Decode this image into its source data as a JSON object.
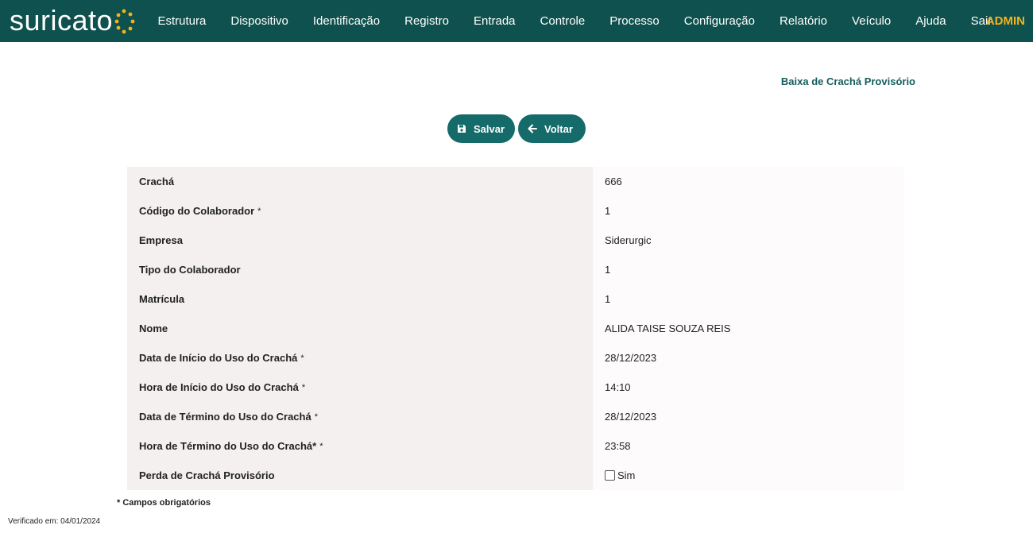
{
  "brand": {
    "name": "suricato",
    "accent": "#f4b31c"
  },
  "nav": {
    "background": "#0f514e",
    "items": [
      "Estrutura",
      "Dispositivo",
      "Identificação",
      "Registro",
      "Entrada",
      "Controle",
      "Processo",
      "Configuração",
      "Relatório",
      "Veículo",
      "Ajuda",
      "Sair"
    ],
    "user": "ADMIN"
  },
  "page": {
    "title": "Baixa de Crachá Provisório"
  },
  "actions": {
    "save_label": "Salvar",
    "save_icon": "floppy-disk-icon",
    "back_label": "Voltar",
    "back_icon": "arrow-left-icon"
  },
  "form": {
    "rows": [
      {
        "label": "Crachá",
        "required": "",
        "value": "666"
      },
      {
        "label": "Código do Colaborador",
        "required": "*",
        "value": "1"
      },
      {
        "label": "Empresa",
        "required": "",
        "value": "Siderurgic"
      },
      {
        "label": "Tipo do Colaborador",
        "required": "",
        "value": "1"
      },
      {
        "label": "Matrícula",
        "required": "",
        "value": "1"
      },
      {
        "label": "Nome",
        "required": "",
        "value": "ALIDA TAISE SOUZA REIS"
      },
      {
        "label": "Data de Início do Uso do Crachá",
        "required": "*",
        "value": "28/12/2023"
      },
      {
        "label": "Hora de Início do Uso do Crachá",
        "required": "*",
        "value": "14:10"
      },
      {
        "label": "Data de Término do Uso do Crachá",
        "required": "*",
        "value": "28/12/2023"
      },
      {
        "label": "Hora de Término do Uso do Crachá*",
        "required": "*",
        "value": "23:58"
      }
    ],
    "lost_badge": {
      "label": "Perda de Crachá Provisório",
      "checkbox_label": "Sim",
      "checked": false
    }
  },
  "footer": {
    "required_note": "* Campos obrigatórios",
    "verified": "Verificado em: 04/01/2024"
  }
}
